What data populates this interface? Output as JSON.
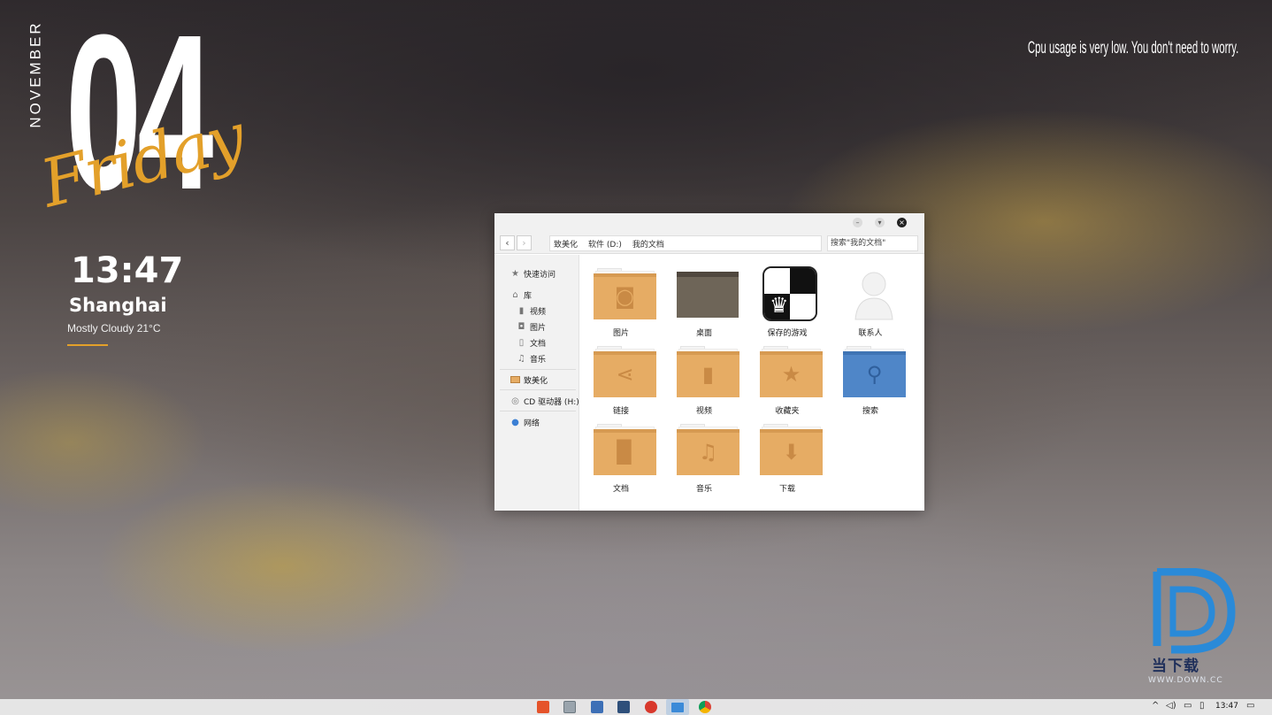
{
  "widget": {
    "month": "NOVEMBER",
    "day": "04",
    "weekday": "Friday",
    "time": "13:47",
    "city": "Shanghai",
    "weather": "Mostly Cloudy 21°C"
  },
  "cpu_note": "Cpu usage is very low. You don't need to worry.",
  "explorer": {
    "breadcrumbs": [
      "致美化",
      "软件 (D:)",
      "我的文档"
    ],
    "search_placeholder": "搜索\"我的文档\"",
    "sidebar": {
      "quick_access": "快速访问",
      "library": "库",
      "library_items": [
        "视频",
        "图片",
        "文档",
        "音乐"
      ],
      "user_folder": "致美化",
      "cd_drive": "CD 驱动器 (H:)",
      "network": "网络"
    },
    "items": [
      {
        "label": "图片",
        "icon": "camera-icon"
      },
      {
        "label": "桌面",
        "icon": "desktop-icon"
      },
      {
        "label": "保存的游戏",
        "icon": "chess-icon"
      },
      {
        "label": "联系人",
        "icon": "contact-icon"
      },
      {
        "label": "链接",
        "icon": "share-icon"
      },
      {
        "label": "视频",
        "icon": "video-icon"
      },
      {
        "label": "收藏夹",
        "icon": "star-icon"
      },
      {
        "label": "搜索",
        "icon": "search-icon"
      },
      {
        "label": "文档",
        "icon": "document-icon"
      },
      {
        "label": "音乐",
        "icon": "music-icon"
      },
      {
        "label": "下载",
        "icon": "download-icon"
      }
    ]
  },
  "taskbar": {
    "time": "13:47",
    "apps": [
      "office-icon",
      "tile-icon",
      "file-icon",
      "terminal-icon",
      "record-icon",
      "folder-icon",
      "chrome-icon"
    ]
  },
  "watermark": {
    "text": "当下载",
    "url": "WWW.DOWN.CC"
  },
  "colors": {
    "accent": "#e3a02a",
    "folder": "#e6ac64",
    "search_folder": "#4f86c8"
  }
}
